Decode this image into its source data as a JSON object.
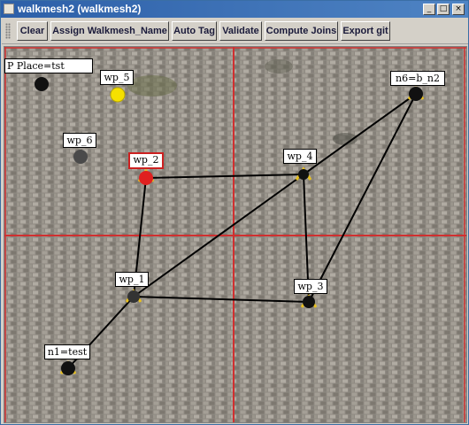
{
  "window": {
    "title": "walkmesh2 (walkmesh2)",
    "controls": {
      "minimize": "_",
      "maximize": "□",
      "close": "×"
    }
  },
  "toolbar": {
    "buttons": [
      "Clear",
      "Assign Walkmesh_Name",
      "Auto Tag",
      "Validate",
      "Compute Joins",
      "Export git"
    ]
  },
  "canvas": {
    "header_label": "P        Place=tst",
    "waypoints": [
      {
        "id": "wp_5",
        "label": "wp_5",
        "color": "#f5e000"
      },
      {
        "id": "wp_6",
        "label": "wp_6",
        "color": "#4a4a4a"
      },
      {
        "id": "wp_2",
        "label": "wp_2",
        "color": "#e02020",
        "selected": true
      },
      {
        "id": "wp_4",
        "label": "wp_4",
        "color": "#111111"
      },
      {
        "id": "wp_1",
        "label": "wp_1",
        "color": "#111111"
      },
      {
        "id": "wp_3",
        "label": "wp_3",
        "color": "#111111"
      },
      {
        "id": "n6",
        "label": "n6=b_n2",
        "color": "#111111"
      },
      {
        "id": "n1",
        "label": "n1=test",
        "color": "#111111"
      },
      {
        "id": "p",
        "label": "",
        "color": "#111111"
      }
    ],
    "edges": [
      [
        "wp_2",
        "wp_4"
      ],
      [
        "wp_2",
        "wp_1"
      ],
      [
        "wp_4",
        "wp_3"
      ],
      [
        "wp_4",
        "n6"
      ],
      [
        "n6",
        "wp_3"
      ],
      [
        "wp_1",
        "wp_3"
      ],
      [
        "wp_1",
        "n1"
      ],
      [
        "wp_1",
        "wp_4"
      ]
    ],
    "colors": {
      "grid_line": "#d03030",
      "edge": "#000000",
      "marker_accent": "#e8c020"
    }
  }
}
